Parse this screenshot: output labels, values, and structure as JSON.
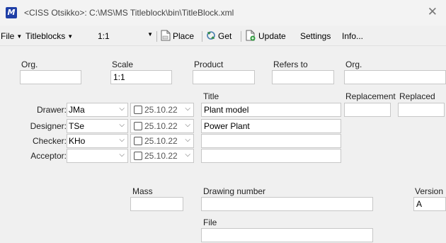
{
  "window": {
    "title": "<CISS Otsikko>: C:\\MS\\MS Titleblock\\bin\\TitleBlock.xml",
    "app_icon_letter": "M",
    "close_glyph": "✕"
  },
  "menu": {
    "file": "File",
    "titleblocks": "Titleblocks",
    "scale_value": "1:1",
    "place": "Place",
    "get": "Get",
    "update": "Update",
    "settings": "Settings",
    "info": "Info..."
  },
  "header_labels": {
    "org1": "Org.",
    "scale": "Scale",
    "product": "Product",
    "refers_to": "Refers to",
    "org2": "Org."
  },
  "header_values": {
    "org1": "",
    "scale": "1:1",
    "product": "",
    "refers_to": "",
    "org2": ""
  },
  "people": [
    {
      "role": "Drawer:",
      "name": "JMa",
      "date": "25.10.22"
    },
    {
      "role": "Designer:",
      "name": "TSe",
      "date": "25.10.22"
    },
    {
      "role": "Checker:",
      "name": "KHo",
      "date": "25.10.22"
    },
    {
      "role": "Acceptor:",
      "name": "",
      "date": "25.10.22"
    }
  ],
  "title_section": {
    "label": "Title",
    "lines": [
      "Plant model",
      "Power Plant",
      "",
      ""
    ]
  },
  "replacement": {
    "replacement_label": "Replacement",
    "replaced_label": "Replaced",
    "replacement_value": "",
    "replaced_value": ""
  },
  "bottom": {
    "mass_label": "Mass",
    "mass_value": "",
    "drawing_number_label": "Drawing number",
    "drawing_number_value": "",
    "version_label": "Version",
    "version_value": "A",
    "file_label": "File",
    "file_value": ""
  },
  "glyphs": {
    "caret": "▼",
    "chevron": "⌵"
  },
  "colors": {
    "app_icon": "#1f3fa6",
    "field_border": "#c7c7c7"
  }
}
